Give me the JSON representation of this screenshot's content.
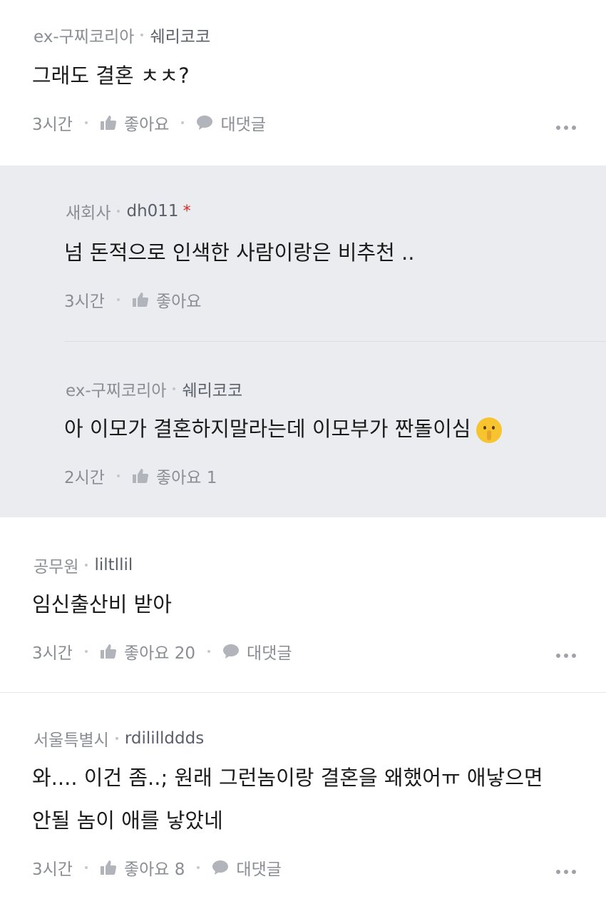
{
  "comments": [
    {
      "company": "ex-구찌코리아",
      "nickname": "쉐리코코",
      "text": "그래도 결혼 ㅊㅊ?",
      "time": "3시간",
      "like_label": "좋아요",
      "reply_label": "대댓글"
    },
    {
      "company": "새회사",
      "nickname": "dh011",
      "author_mark": "*",
      "text": "넘 돈적으로 인색한 사람이랑은 비추천 ..",
      "time": "3시간",
      "like_label": "좋아요"
    },
    {
      "company": "ex-구찌코리아",
      "nickname": "쉐리코코",
      "text": "아 이모가 결혼하지말라는데 이모부가 짠돌이심",
      "emoji": "shushing-face",
      "time": "2시간",
      "like_label": "좋아요 1"
    },
    {
      "company": "공무원",
      "nickname": "liltllil",
      "text": "임신출산비 받아",
      "time": "3시간",
      "like_label": "좋아요 20",
      "reply_label": "대댓글"
    },
    {
      "company": "서울특별시",
      "nickname": "rdilillddds",
      "text_line1": "와.... 이건 좀..; 원래 그런놈이랑 결혼을 왜했어ㅠ 애낳으면",
      "text_line2": "안될 놈이 애를 낳았네",
      "time": "3시간",
      "like_label": "좋아요 8",
      "reply_label": "대댓글"
    }
  ],
  "icons": {
    "like": "thumbs-up-icon",
    "reply": "speech-bubble-icon",
    "more": "more-dots-icon"
  },
  "colors": {
    "reply_background": "#ebecf0",
    "meta_text": "#8a8d94",
    "author_star": "#d12b2b"
  }
}
